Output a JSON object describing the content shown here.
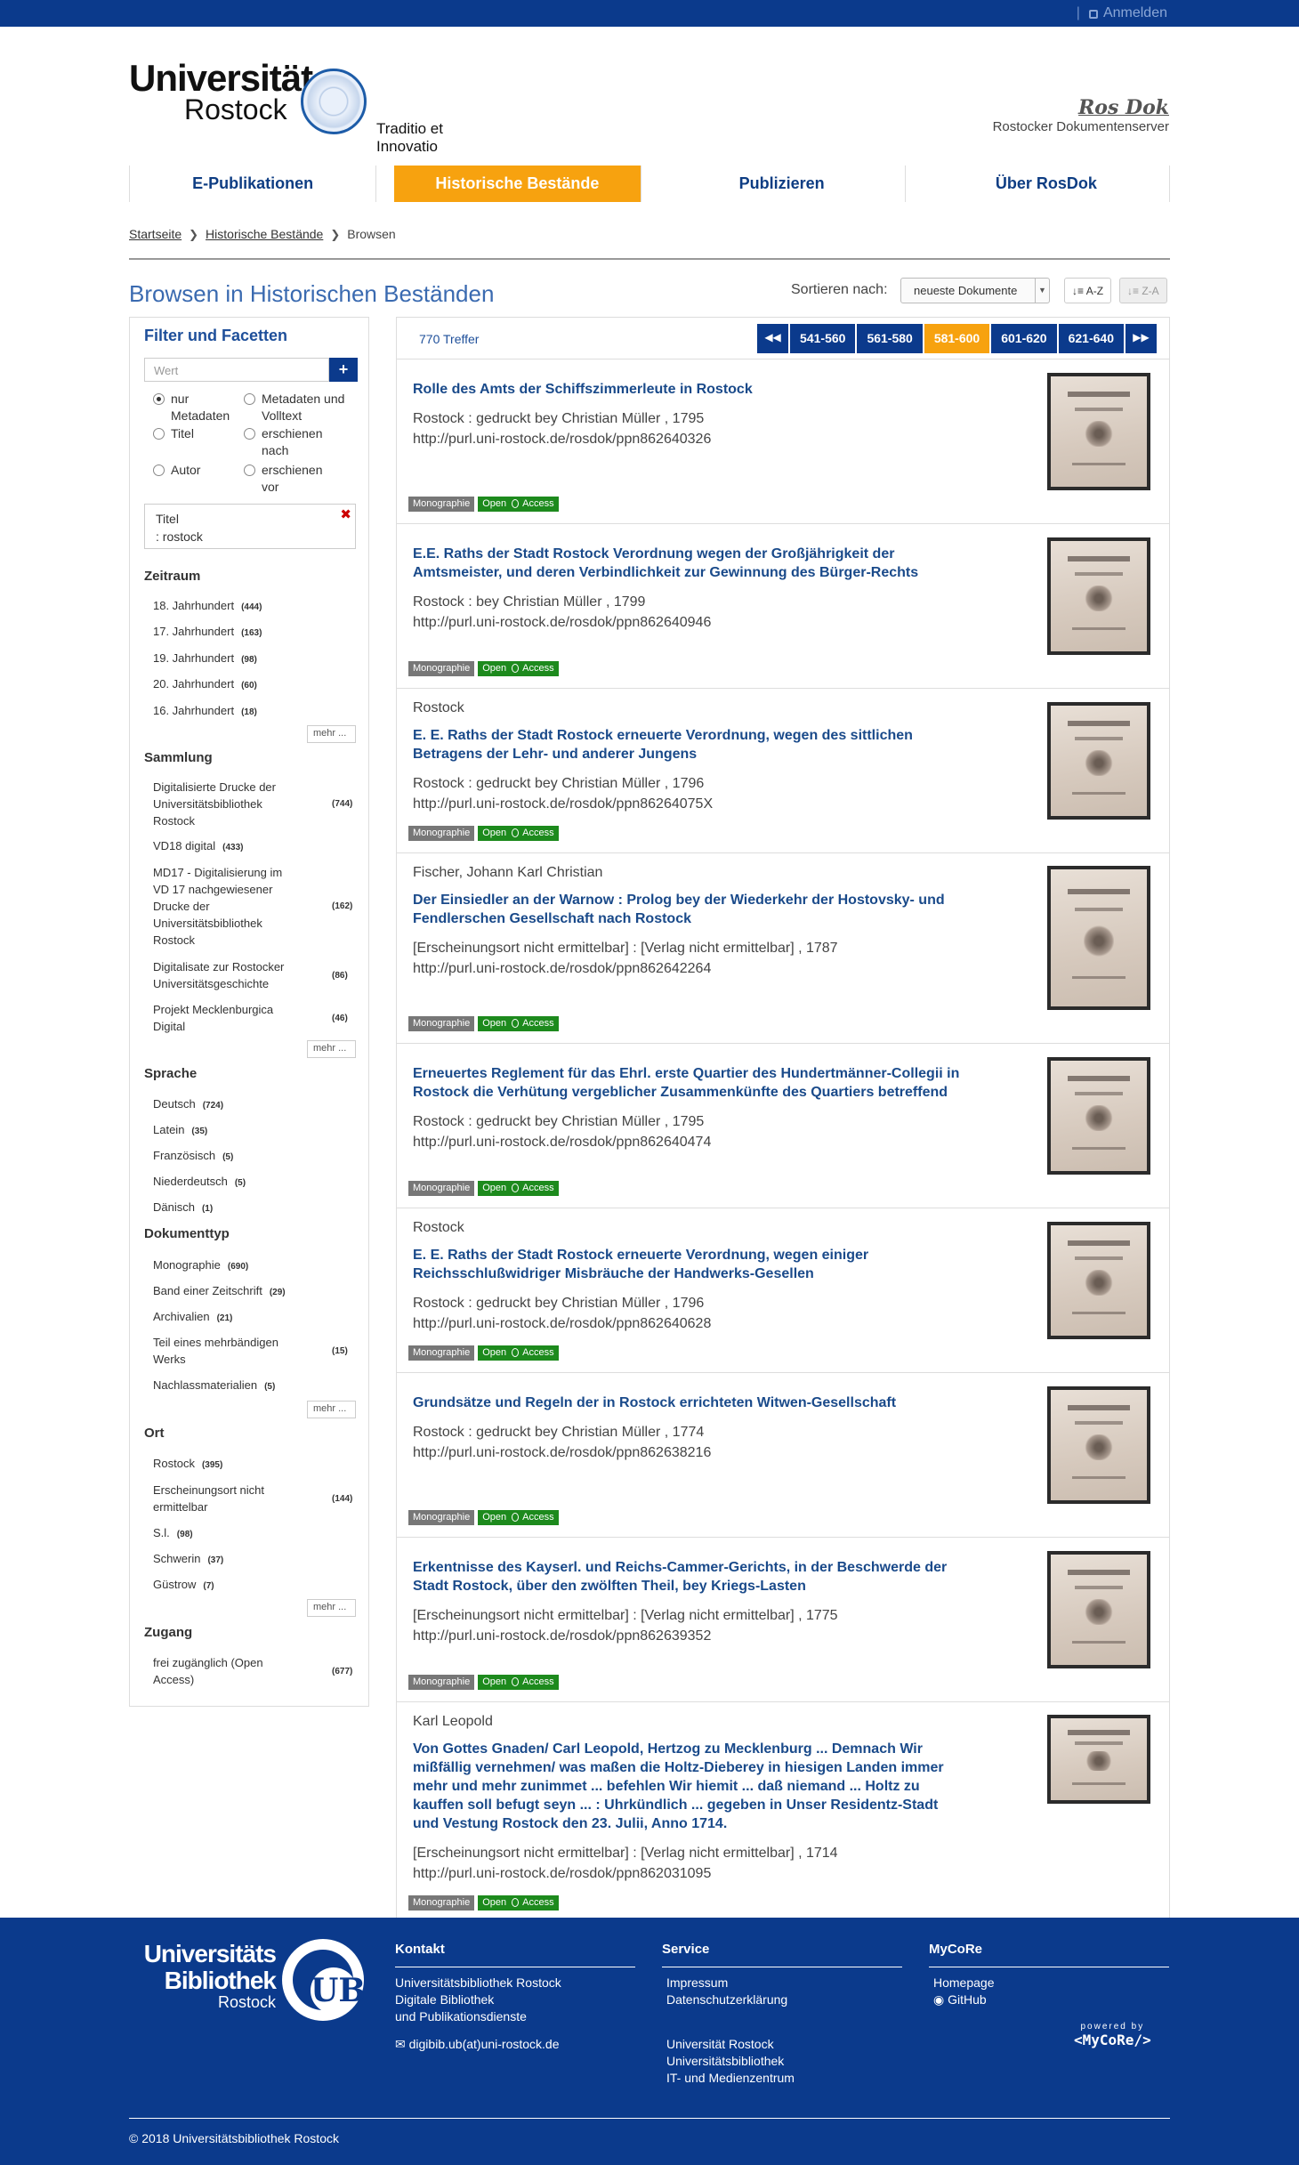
{
  "topbar": {
    "login_label": "Anmelden"
  },
  "header": {
    "university_line1": "Universität",
    "university_line2": "Rostock",
    "motto": "Traditio et Innovatio",
    "rosdok_logo": "Ros Dok",
    "rosdok_subtitle": "Rostocker Dokumentenserver"
  },
  "nav": {
    "items": [
      {
        "label": "E-Publikationen"
      },
      {
        "label": "Historische Bestände"
      },
      {
        "label": "Publizieren"
      },
      {
        "label": "Über RosDok"
      }
    ]
  },
  "breadcrumb": {
    "items": [
      "Startseite",
      "Historische Bestände",
      "Browsen"
    ]
  },
  "page_title": "Browsen in Historischen Beständen",
  "sort": {
    "label": "Sortieren nach:",
    "selected": "neueste Dokumente",
    "asc": "A-Z",
    "desc": "Z-A"
  },
  "sidebar": {
    "title": "Filter und Facetten",
    "search_placeholder": "Wert",
    "radios": [
      "nur Metadaten",
      "Metadaten und Volltext",
      "Titel",
      "erschienen nach",
      "Autor",
      "erschienen vor"
    ],
    "active_filter_line1": "Titel",
    "active_filter_line2": ": rostock",
    "more_label": "mehr ...",
    "facets": {
      "zeitraum": {
        "title": "Zeitraum",
        "items": [
          {
            "label": "18. Jahrhundert",
            "count": "(444)"
          },
          {
            "label": "17. Jahrhundert",
            "count": "(163)"
          },
          {
            "label": "19. Jahrhundert",
            "count": "(98)"
          },
          {
            "label": "20. Jahrhundert",
            "count": "(60)"
          },
          {
            "label": "16. Jahrhundert",
            "count": "(18)"
          }
        ]
      },
      "sammlung": {
        "title": "Sammlung",
        "items": [
          {
            "label": "Digitalisierte Drucke der Universitätsbibliothek Rostock",
            "count": "(744)"
          },
          {
            "label": "VD18 digital",
            "count": "(433)"
          },
          {
            "label": "MD17 - Digitalisierung im VD 17 nachgewiesener Drucke der Universitätsbibliothek Rostock",
            "count": "(162)"
          },
          {
            "label": "Digitalisate zur Rostocker Universitätsgeschichte",
            "count": "(86)"
          },
          {
            "label": "Projekt Mecklenburgica Digital",
            "count": "(46)"
          }
        ]
      },
      "sprache": {
        "title": "Sprache",
        "items": [
          {
            "label": "Deutsch",
            "count": "(724)"
          },
          {
            "label": "Latein",
            "count": "(35)"
          },
          {
            "label": "Französisch",
            "count": "(5)"
          },
          {
            "label": "Niederdeutsch",
            "count": "(5)"
          },
          {
            "label": "Dänisch",
            "count": "(1)"
          }
        ]
      },
      "dokumenttyp": {
        "title": "Dokumenttyp",
        "items": [
          {
            "label": "Monographie",
            "count": "(690)"
          },
          {
            "label": "Band einer Zeitschrift",
            "count": "(29)"
          },
          {
            "label": "Archivalien",
            "count": "(21)"
          },
          {
            "label": "Teil eines mehrbändigen Werks",
            "count": "(15)"
          },
          {
            "label": "Nachlassmaterialien",
            "count": "(5)"
          }
        ]
      },
      "ort": {
        "title": "Ort",
        "items": [
          {
            "label": "Rostock",
            "count": "(395)"
          },
          {
            "label": "Erscheinungsort nicht ermittelbar",
            "count": "(144)"
          },
          {
            "label": "S.l.",
            "count": "(98)"
          },
          {
            "label": "Schwerin",
            "count": "(37)"
          },
          {
            "label": "Güstrow",
            "count": "(7)"
          }
        ]
      },
      "zugang": {
        "title": "Zugang",
        "items": [
          {
            "label": "frei zugänglich (Open Access)",
            "count": "(677)"
          }
        ]
      }
    }
  },
  "results": {
    "count_label": "770 Treffer",
    "pages": [
      "541-560",
      "561-580",
      "581-600",
      "601-620",
      "621-640"
    ],
    "type_tag": "Monographie",
    "access_open": "Open",
    "access_word": "Access",
    "items": [
      {
        "author": "",
        "title": "Rolle des Amts der Schiffszimmerleute in Rostock",
        "pub": "Rostock : gedruckt bey Christian Müller , 1795",
        "url": "http://purl.uni-rostock.de/rosdok/ppn862640326"
      },
      {
        "author": "",
        "title": "E.E. Raths der Stadt Rostock Verordnung wegen der Großjährigkeit der Amtsmeister, und deren Verbindlichkeit zur Gewinnung des Bürger-Rechts",
        "pub": "Rostock : bey Christian Müller , 1799",
        "url": "http://purl.uni-rostock.de/rosdok/ppn862640946"
      },
      {
        "author": "Rostock",
        "title": "E. E. Raths der Stadt Rostock erneuerte Verordnung, wegen des sittlichen Betragens der Lehr- und anderer Jungens",
        "pub": "Rostock : gedruckt bey Christian Müller , 1796",
        "url": "http://purl.uni-rostock.de/rosdok/ppn86264075X"
      },
      {
        "author": "Fischer, Johann Karl Christian",
        "title": "Der Einsiedler an der Warnow : Prolog bey der Wiederkehr der Hostovsky- und Fendlerschen Gesellschaft nach Rostock",
        "pub": "[Erscheinungsort nicht ermittelbar] : [Verlag nicht ermittelbar] , 1787",
        "url": "http://purl.uni-rostock.de/rosdok/ppn862642264"
      },
      {
        "author": "",
        "title": "Erneuertes Reglement für das Ehrl. erste Quartier des Hundertmänner-Collegii in Rostock die Verhütung vergeblicher Zusammenkünfte des Quartiers betreffend",
        "pub": "Rostock : gedruckt bey Christian Müller , 1795",
        "url": "http://purl.uni-rostock.de/rosdok/ppn862640474"
      },
      {
        "author": "Rostock",
        "title": "E. E. Raths der Stadt Rostock erneuerte Verordnung, wegen einiger Reichsschlußwidriger Misbräuche der Handwerks-Gesellen",
        "pub": "Rostock : gedruckt bey Christian Müller , 1796",
        "url": "http://purl.uni-rostock.de/rosdok/ppn862640628"
      },
      {
        "author": "",
        "title": "Grundsätze und Regeln der in Rostock errichteten Witwen-Gesellschaft",
        "pub": "Rostock : gedruckt bey Christian Müller , 1774",
        "url": "http://purl.uni-rostock.de/rosdok/ppn862638216"
      },
      {
        "author": "",
        "title": "Erkentnisse des Kayserl. und Reichs-Cammer-Gerichts, in der Beschwerde der Stadt Rostock, über den zwölften Theil, bey Kriegs-Lasten",
        "pub": "[Erscheinungsort nicht ermittelbar] : [Verlag nicht ermittelbar] , 1775",
        "url": "http://purl.uni-rostock.de/rosdok/ppn862639352"
      },
      {
        "author": "Karl Leopold",
        "title": "Von Gottes Gnaden/ Carl Leopold, Hertzog zu Mecklenburg ... Demnach Wir mißfällig vernehmen/ was maßen die Holtz-Dieberey in hiesigen Landen immer mehr und mehr zunimmet ... befehlen Wir hiemit ... daß niemand ... Holtz zu kauffen soll befugt seyn ... : Uhrkündlich ... gegeben in Unser Residentz-Stadt und Vestung Rostock den 23. Julii, Anno 1714.",
        "pub": "[Erscheinungsort nicht ermittelbar] : [Verlag nicht ermittelbar] , 1714",
        "url": "http://purl.uni-rostock.de/rosdok/ppn862031095"
      }
    ]
  },
  "footer": {
    "logo_line1": "Universitäts",
    "logo_line2": "Bibliothek",
    "logo_line3": "Rostock",
    "logo_mark": "UB",
    "kontakt": {
      "title": "Kontakt",
      "lines": [
        "Universitätsbibliothek Rostock",
        "Digitale Bibliothek",
        "und Publikationsdienste"
      ],
      "email": "digibib.ub(at)uni-rostock.de"
    },
    "service": {
      "title": "Service",
      "links": [
        "Impressum",
        "Datenschutzerklärung"
      ],
      "links2": [
        "Universität Rostock",
        "Universitätsbibliothek",
        "IT- und Medienzentrum"
      ]
    },
    "mycore": {
      "title": "MyCoRe",
      "links": [
        "Homepage",
        "GitHub"
      ]
    },
    "powered_by": "powered by",
    "mycore_logo": "<MyCoRe/>",
    "copyright": "© 2018 Universitätsbibliothek Rostock"
  },
  "colors": {
    "primary": "#0b3a8c",
    "accent": "#f7a20f",
    "open_access": "#1d8a1d",
    "tag_grey": "#777777",
    "title_blue": "#3a6ab0"
  }
}
